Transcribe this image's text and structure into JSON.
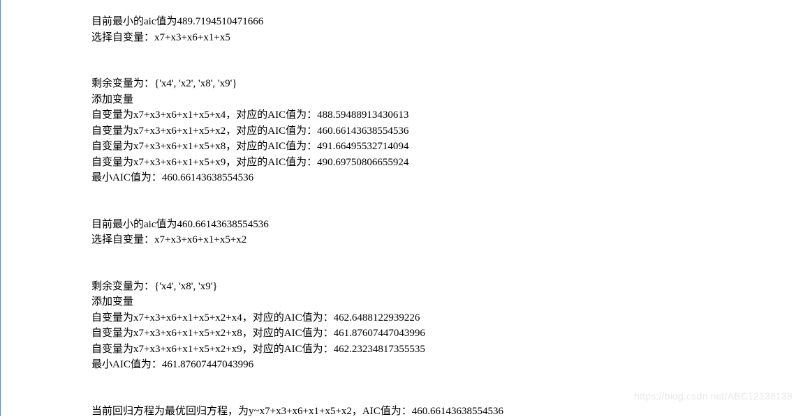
{
  "block1": {
    "min_aic_line": "目前最小的aic值为489.7194510471666",
    "select_vars_line": "选择自变量：x7+x3+x6+x1+x5"
  },
  "block2": {
    "remaining_vars_line": "剩余变量为：{'x4', 'x2', 'x8', 'x9'}",
    "add_var_header": "添加变量",
    "candidate1": "自变量为x7+x3+x6+x1+x5+x4，对应的AIC值为：488.59488913430613",
    "candidate2": "自变量为x7+x3+x6+x1+x5+x2，对应的AIC值为：460.66143638554536",
    "candidate3": "自变量为x7+x3+x6+x1+x5+x8，对应的AIC值为：491.66495532714094",
    "candidate4": "自变量为x7+x3+x6+x1+x5+x9，对应的AIC值为：490.69750806655924",
    "min_aic_line": "最小AIC值为：460.66143638554536"
  },
  "block3": {
    "min_aic_line": "目前最小的aic值为460.66143638554536",
    "select_vars_line": "选择自变量：x7+x3+x6+x1+x5+x2"
  },
  "block4": {
    "remaining_vars_line": "剩余变量为：{'x4', 'x8', 'x9'}",
    "add_var_header": "添加变量",
    "candidate1": "自变量为x7+x3+x6+x1+x5+x2+x4，对应的AIC值为：462.6488122939226",
    "candidate2": "自变量为x7+x3+x6+x1+x5+x2+x8，对应的AIC值为：461.87607447043996",
    "candidate3": "自变量为x7+x3+x6+x1+x5+x2+x9，对应的AIC值为：462.23234817355535",
    "min_aic_line": "最小AIC值为：461.87607447043996"
  },
  "conclusion": {
    "final_line": "当前回归方程为最优回归方程，为y~x7+x3+x6+x1+x5+x2，AIC值为：460.66143638554536"
  },
  "watermark": "https://blog.csdn.net/ABC12138138"
}
